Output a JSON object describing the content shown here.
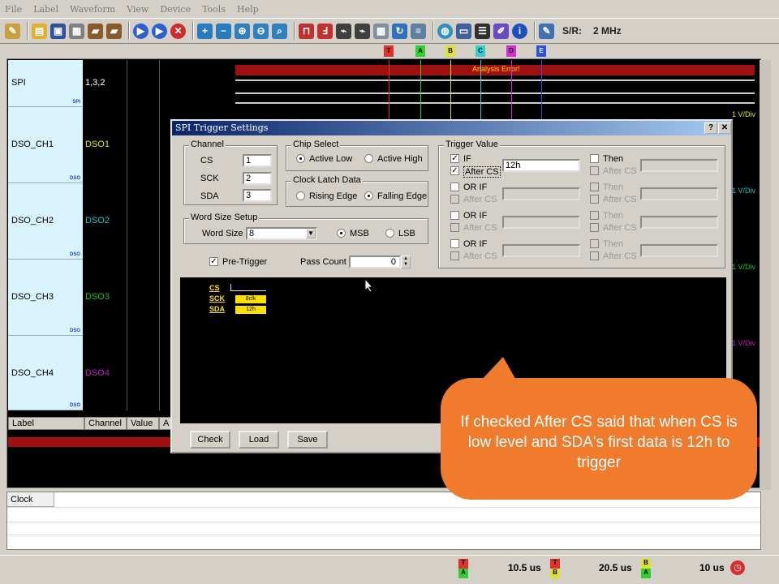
{
  "menu": [
    "File",
    "Label",
    "Waveform",
    "View",
    "Device",
    "Tools",
    "Help"
  ],
  "toolbar": {
    "sr_label": "S/R:",
    "sr_value": "2 MHz"
  },
  "markers": [
    "T",
    "A",
    "B",
    "C",
    "D",
    "E"
  ],
  "channels": [
    {
      "label": "SPI",
      "tag": "SPI",
      "value": "1,3,2",
      "value_color": "#ffffff"
    },
    {
      "label": "DSO_CH1",
      "tag": "DSO",
      "value": "DSO1",
      "value_color": "#e6e600"
    },
    {
      "label": "DSO_CH2",
      "tag": "DSO",
      "value": "DSO2",
      "value_color": "#19c6c6"
    },
    {
      "label": "DSO_CH3",
      "tag": "DSO",
      "value": "DSO3",
      "value_color": "#19c619"
    },
    {
      "label": "DSO_CH4",
      "tag": "DSO",
      "value": "DSO4",
      "value_color": "#c619c6"
    }
  ],
  "analysis_error": "Analysis Error!",
  "vdiv": [
    "1 V/Div",
    "1 V/Div",
    "1 V/Div",
    "1 V/Div"
  ],
  "columns": {
    "label": "Label",
    "channel": "Channel",
    "value": "Value",
    "a": "A"
  },
  "clock_label": "Clock",
  "status": [
    {
      "top": "T",
      "bottom": "A",
      "value": "10.5 us"
    },
    {
      "top": "T",
      "bottom": "B",
      "value": "20.5 us"
    },
    {
      "top": "B",
      "bottom": "A",
      "value": "10 us"
    }
  ],
  "dialog": {
    "title": "SPI Trigger Settings",
    "help_btn": "?",
    "close_btn": "✕",
    "channel": {
      "title": "Channel",
      "cs_label": "CS",
      "cs": "1",
      "sck_label": "SCK",
      "sck": "2",
      "sda_label": "SDA",
      "sda": "3"
    },
    "chip_select": {
      "title": "Chip Select",
      "low": "Active Low",
      "high": "Active High"
    },
    "clock_latch": {
      "title": "Clock Latch Data",
      "rising": "Rising Edge",
      "falling": "Falling Edge"
    },
    "word_size": {
      "title": "Word Size Setup",
      "label": "Word Size",
      "value": "8",
      "msb": "MSB",
      "lsb": "LSB"
    },
    "pre_trigger": "Pre-Trigger",
    "pass_count_label": "Pass Count",
    "pass_count": "0",
    "trigger_value": {
      "title": "Trigger Value",
      "rows": [
        {
          "cond": "IF",
          "after": "After CS",
          "value": "12h",
          "then": "Then",
          "then_after": "After CS",
          "checked": true
        },
        {
          "cond": "OR IF",
          "after": "After CS",
          "value": "",
          "then": "Then",
          "then_after": "After CS",
          "checked": false
        },
        {
          "cond": "OR IF",
          "after": "After CS",
          "value": "",
          "then": "Then",
          "then_after": "After CS",
          "checked": false
        },
        {
          "cond": "OR IF",
          "after": "After CS",
          "value": "",
          "then": "Then",
          "then_after": "After CS",
          "checked": false
        }
      ]
    },
    "preview": {
      "cs": "CS",
      "sck": "SCK",
      "sda": "SDA",
      "sck_val": "8clk",
      "sda_val": "12h"
    },
    "buttons": {
      "check": "Check",
      "load": "Load",
      "save": "Save"
    }
  },
  "callout_text": "If checked After CS said that when CS is low level and SDA's first data is 12h to trigger"
}
